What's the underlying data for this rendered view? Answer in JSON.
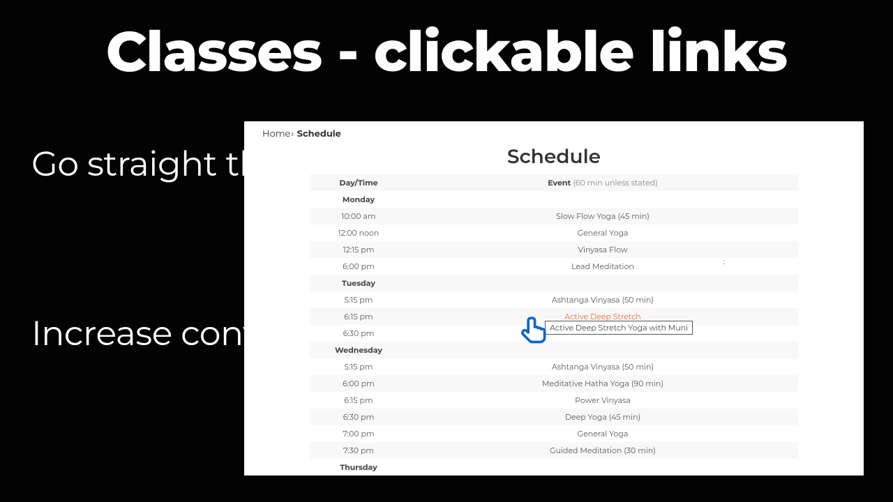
{
  "hero_title": "Classes - clickable links",
  "side_text_1": "Go straight through to purchase",
  "side_text_2": "Increase conversion",
  "breadcrumb": {
    "home": "Home",
    "sep": "›",
    "current": "Schedule"
  },
  "page_title": "Schedule",
  "table": {
    "header_time": "Day/Time",
    "header_event_bold": "Event",
    "header_event_sub": " (60 min unless stated)"
  },
  "rows": [
    {
      "type": "day",
      "text": "Monday"
    },
    {
      "type": "item",
      "time": "10:00 am",
      "event": "Slow Flow Yoga (45 min)"
    },
    {
      "type": "item",
      "time": "12:00 noon",
      "event": "General Yoga"
    },
    {
      "type": "item",
      "time": "12:15 pm",
      "event": "Vinyasa Flow"
    },
    {
      "type": "item",
      "time": "6:00 pm",
      "event": "Lead Meditation"
    },
    {
      "type": "day",
      "text": "Tuesday"
    },
    {
      "type": "item",
      "time": "5:15 pm",
      "event": "Ashtanga Vinyasa (50 min)"
    },
    {
      "type": "item",
      "time": "6:15 pm",
      "event": "Active Deep Stretch",
      "link": true
    },
    {
      "type": "item",
      "time": "6:30 pm",
      "event": ""
    },
    {
      "type": "day",
      "text": "Wednesday"
    },
    {
      "type": "item",
      "time": "5:15 pm",
      "event": "Ashtanga Vinyasa (50 min)"
    },
    {
      "type": "item",
      "time": "6:00 pm",
      "event": "Meditative Hatha Yoga (90 min)"
    },
    {
      "type": "item",
      "time": "6:15 pm",
      "event": "Power Vinyasa"
    },
    {
      "type": "item",
      "time": "6:30 pm",
      "event": "Deep Yoga (45 min)"
    },
    {
      "type": "item",
      "time": "7:00 pm",
      "event": "General Yoga"
    },
    {
      "type": "item",
      "time": "7:30 pm",
      "event": "Guided Meditation (30 min)"
    },
    {
      "type": "day",
      "text": "Thursday"
    }
  ],
  "tooltip_text": "Active Deep Stretch Yoga with Muni",
  "stray_colon": ":"
}
